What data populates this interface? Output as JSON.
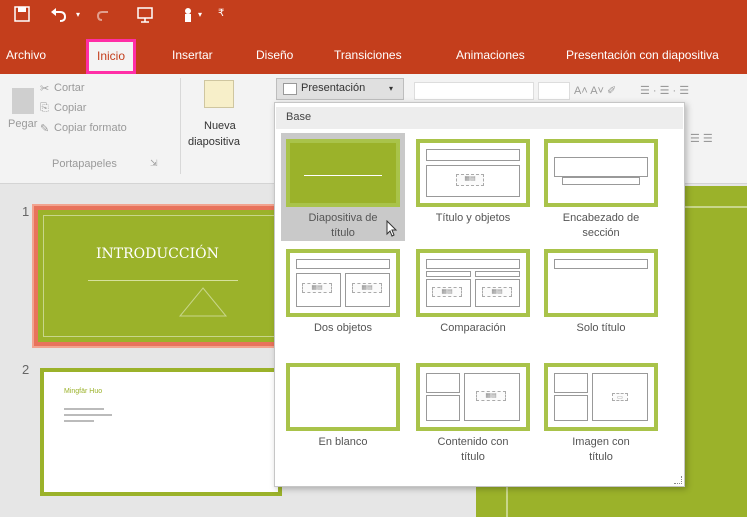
{
  "quick_access": {
    "save_icon": "save-icon",
    "undo_icon": "undo-icon",
    "redo_icon": "redo-icon",
    "start_icon": "start-from-beginning-icon",
    "touch_icon": "touch-mode-icon",
    "customize_icon": "customize-qat-icon"
  },
  "tabs": [
    "Archivo",
    "Inicio",
    "Insertar",
    "Diseño",
    "Transiciones",
    "Animaciones",
    "Presentación con diapositiva"
  ],
  "active_tab": "Inicio",
  "ribbon": {
    "clipboard": {
      "paste_label": "Pegar",
      "cut_label": "Cortar",
      "copy_label": "Copiar",
      "format_label": "Copiar formato",
      "group_label": "Portapapeles"
    },
    "new_slide_label": "Nueva",
    "new_slide_label2": "diapositiva",
    "layout_button_label": "Presentación"
  },
  "dropdown": {
    "header": "Base",
    "layouts": [
      {
        "line1": "Diapositiva de",
        "line2": "título"
      },
      {
        "line1": "Título y objetos",
        "line2": ""
      },
      {
        "line1": "Encabezado de",
        "line2": "sección"
      },
      {
        "line1": "Dos objetos",
        "line2": ""
      },
      {
        "line1": "Comparación",
        "line2": ""
      },
      {
        "line1": "Solo título",
        "line2": ""
      },
      {
        "line1": "En blanco",
        "line2": ""
      },
      {
        "line1": "Contenido con",
        "line2": "título"
      },
      {
        "line1": "Imagen con",
        "line2": "título"
      }
    ]
  },
  "slides": [
    {
      "number": "1",
      "title": "INTRODUCCIÓN"
    },
    {
      "number": "2",
      "title": "Mingfär Huo"
    }
  ],
  "colors": {
    "brand": "#c43e1c",
    "slide_green": "#9bb22a",
    "highlight": "#ff2ea6"
  }
}
